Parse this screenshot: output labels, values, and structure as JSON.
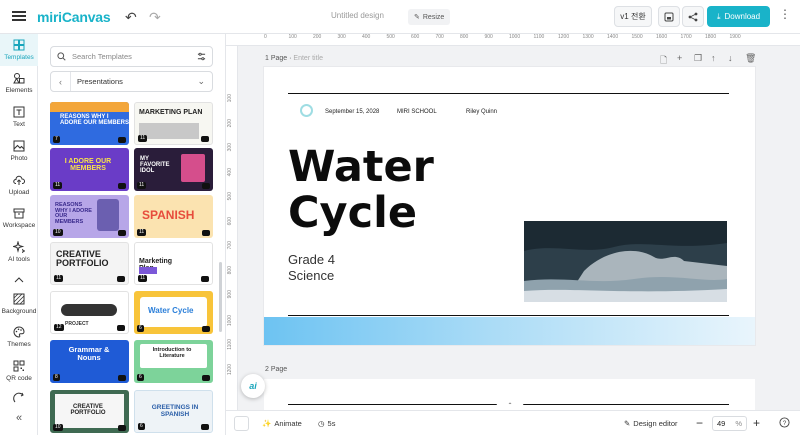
{
  "app": {
    "logo_text": "miriCanvas"
  },
  "header": {
    "doc_title": "Untitled design",
    "resize_label": "Resize",
    "version_label": "v1 전환",
    "download_label": "Download",
    "brand_color": "#19b3c9"
  },
  "rail": {
    "items": [
      {
        "label": "Templates",
        "icon": "templates-icon"
      },
      {
        "label": "Elements",
        "icon": "elements-icon"
      },
      {
        "label": "Text",
        "icon": "text-icon"
      },
      {
        "label": "Photo",
        "icon": "photo-icon"
      },
      {
        "label": "Upload",
        "icon": "upload-icon"
      },
      {
        "label": "Workspace",
        "icon": "workspace-icon"
      },
      {
        "label": "AI tools",
        "icon": "ai-tools-icon"
      },
      {
        "label": "Background",
        "icon": "background-icon"
      },
      {
        "label": "Themes",
        "icon": "themes-icon"
      },
      {
        "label": "QR code",
        "icon": "qr-code-icon"
      }
    ]
  },
  "panel": {
    "search_placeholder": "Search Templates",
    "category": "Presentations",
    "templates": [
      {
        "title": "REASONS WHY I ADORE OUR MEMBERS",
        "count": "7"
      },
      {
        "title": "MARKETING PLAN",
        "count": "11"
      },
      {
        "title": "I ADORE OUR MEMBERS",
        "count": "11"
      },
      {
        "title": "MY FAVORITE IDOL",
        "count": "11"
      },
      {
        "title": "REASONS WHY I ADORE OUR MEMBERS",
        "count": "10"
      },
      {
        "title": "SPANISH",
        "count": "11"
      },
      {
        "title": "CREATIVE PORTFOLIO",
        "count": "11"
      },
      {
        "title": "Marketing Plan",
        "count": "11"
      },
      {
        "title": "PROJECT",
        "count": "12"
      },
      {
        "title": "Water Cycle",
        "count": "6"
      },
      {
        "title": "Grammar & Nouns",
        "count": "8"
      },
      {
        "title": "Introduction to Literature",
        "count": "6"
      },
      {
        "title": "CREATIVE PORTFOLIO",
        "count": "10"
      },
      {
        "title": "GREETINGS IN SPANISH",
        "count": "6"
      }
    ]
  },
  "canvas": {
    "page1_label": "1 Page",
    "page1_title_placeholder": "Enter title",
    "page2_label": "2 Page",
    "ruler_h": [
      "0",
      "100",
      "200",
      "300",
      "400",
      "500",
      "600",
      "700",
      "800",
      "900",
      "1000",
      "1100",
      "1200",
      "1300",
      "1400",
      "1500",
      "1600",
      "1700",
      "1800",
      "1900"
    ],
    "ruler_v": [
      "100",
      "200",
      "300",
      "400",
      "500",
      "600",
      "700",
      "800",
      "900",
      "1000",
      "1100",
      "1200"
    ],
    "slide": {
      "date": "September 15, 2028",
      "school": "MIRI SCHOOL",
      "author": "Riley Quinn",
      "title_line1": "Water",
      "title_line2": "Cycle",
      "subtitle_line1": "Grade 4",
      "subtitle_line2": "Science"
    }
  },
  "bottombar": {
    "animate_label": "Animate",
    "duration_label": "5s",
    "design_editor_label": "Design editor",
    "zoom_value": "49",
    "zoom_unit": "%"
  }
}
